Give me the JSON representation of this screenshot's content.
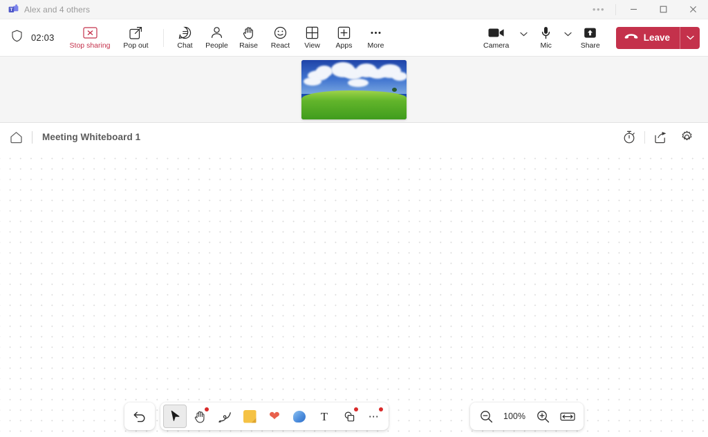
{
  "titlebar": {
    "app_icon": "teams-logo-icon",
    "title": "Alex and 4 others",
    "overflow_label": "•••",
    "minimize_label": "Minimize",
    "maximize_label": "Maximize",
    "close_label": "Close"
  },
  "meeting_toolbar": {
    "shield_icon": "shield-icon",
    "timer": "02:03",
    "items": [
      {
        "label": "Stop sharing",
        "icon": "stop-sharing-icon",
        "danger": true
      },
      {
        "label": "Pop out",
        "icon": "pop-out-icon",
        "danger": false
      },
      {
        "label": "Chat",
        "icon": "chat-icon",
        "danger": false
      },
      {
        "label": "People",
        "icon": "people-icon",
        "danger": false
      },
      {
        "label": "Raise",
        "icon": "raise-hand-icon",
        "danger": false
      },
      {
        "label": "React",
        "icon": "react-smiley-icon",
        "danger": false
      },
      {
        "label": "View",
        "icon": "view-grid-icon",
        "danger": false
      },
      {
        "label": "Apps",
        "icon": "apps-plus-icon",
        "danger": false
      },
      {
        "label": "More",
        "icon": "more-ellipsis-icon",
        "danger": false
      }
    ],
    "camera": {
      "label": "Camera",
      "icon": "camera-icon",
      "caret": "chevron-down-icon"
    },
    "mic": {
      "label": "Mic",
      "icon": "microphone-icon",
      "caret": "chevron-down-icon"
    },
    "share": {
      "label": "Share",
      "icon": "share-screen-icon"
    },
    "leave": {
      "label": "Leave",
      "icon": "hangup-phone-icon",
      "caret": "chevron-down-icon",
      "color": "#c4314b"
    }
  },
  "shared_content": {
    "thumbnail_alt": "Shared screen preview: blue sky with clouds over green hills"
  },
  "whiteboard_header": {
    "home_icon": "home-icon",
    "title": "Meeting Whiteboard 1",
    "actions": [
      {
        "icon": "timer-stopwatch-icon",
        "label": "Timer"
      },
      {
        "icon": "share-export-icon",
        "label": "Share"
      },
      {
        "icon": "gear-settings-icon",
        "label": "Settings"
      }
    ]
  },
  "canvas": {
    "background": "dot-grid",
    "dot_color": "#dcdcdc"
  },
  "bottom_toolbar": {
    "undo": {
      "label": "Undo",
      "icon": "undo-arrow-icon"
    },
    "tools": [
      {
        "name": "select",
        "icon": "cursor-arrow-icon",
        "label": "Select",
        "active": true,
        "badge": false
      },
      {
        "name": "pan",
        "icon": "hand-pan-icon",
        "label": "Pan",
        "active": false,
        "badge": true
      },
      {
        "name": "pen",
        "icon": "pen-ink-icon",
        "label": "Pen",
        "active": false,
        "badge": false
      },
      {
        "name": "note",
        "icon": "sticky-note-icon",
        "label": "Note",
        "active": false,
        "badge": false
      },
      {
        "name": "reaction",
        "icon": "heart-icon",
        "label": "Reaction",
        "active": false,
        "badge": false
      },
      {
        "name": "comment",
        "icon": "chat-bubble-icon",
        "label": "Comment",
        "active": false,
        "badge": false
      },
      {
        "name": "text",
        "icon": "text-tool-icon",
        "label": "Text",
        "active": false,
        "badge": false
      },
      {
        "name": "shapes",
        "icon": "shapes-icon",
        "label": "Shapes",
        "active": false,
        "badge": true
      },
      {
        "name": "more",
        "icon": "more-ellipsis-icon",
        "label": "More",
        "active": false,
        "badge": true
      }
    ],
    "zoom": {
      "out_icon": "zoom-out-icon",
      "level": "100%",
      "in_icon": "zoom-in-icon",
      "fit_icon": "fit-to-screen-icon"
    }
  }
}
